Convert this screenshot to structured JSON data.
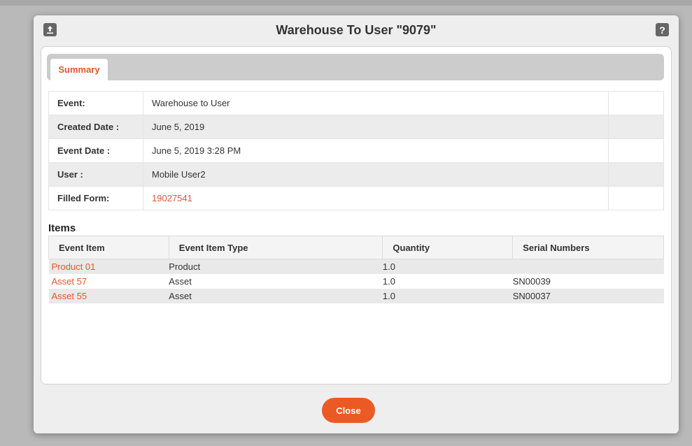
{
  "dialog": {
    "title": "Warehouse To User \"9079\"",
    "upload_icon": "upload-icon",
    "help_icon": "help-icon",
    "close_label": "Close"
  },
  "tabs": [
    {
      "label": "Summary",
      "active": true
    }
  ],
  "summary": [
    {
      "label": "Event:",
      "value": "Warehouse to User"
    },
    {
      "label": "Created Date :",
      "value": "June 5, 2019"
    },
    {
      "label": "Event Date :",
      "value": "June 5, 2019 3:28 PM"
    },
    {
      "label": "User :",
      "value": "Mobile User2"
    },
    {
      "label": "Filled Form:",
      "value": "19027541",
      "link": true
    }
  ],
  "items": {
    "title": "Items",
    "headers": [
      "Event Item",
      "Event Item Type",
      "Quantity",
      "Serial Numbers"
    ],
    "rows": [
      {
        "item": "Product 01",
        "type": "Product",
        "quantity": "1.0",
        "serial": ""
      },
      {
        "item": "Asset 57",
        "type": "Asset",
        "quantity": "1.0",
        "serial": "SN00039"
      },
      {
        "item": "Asset 55",
        "type": "Asset",
        "quantity": "1.0",
        "serial": "SN00037"
      }
    ]
  },
  "colors": {
    "accent": "#eb5a24",
    "backdrop": "#b9b9b9"
  }
}
